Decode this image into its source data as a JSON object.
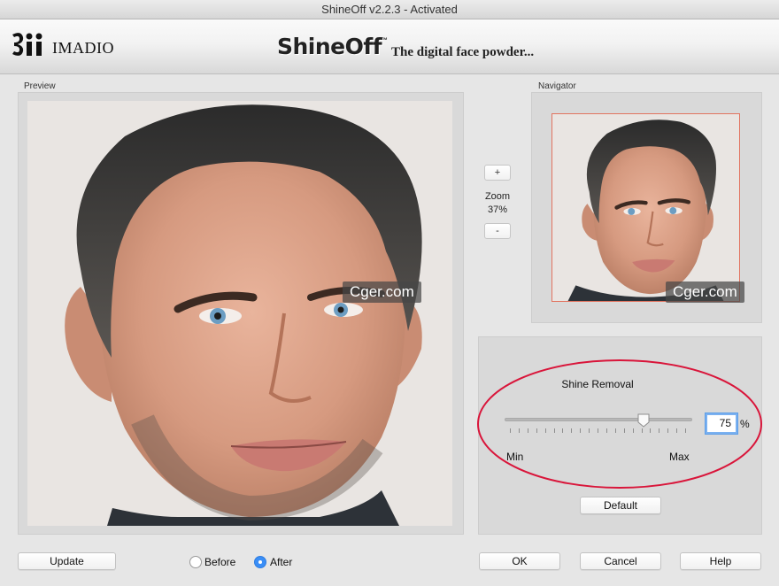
{
  "window": {
    "title": "ShineOff v2.2.3 - Activated"
  },
  "banner": {
    "company": "IMADIO",
    "product": "ShineOff",
    "trademark": "™",
    "tagline": "The digital face powder..."
  },
  "preview": {
    "label": "Preview",
    "watermark": "Cger.com"
  },
  "navigator": {
    "label": "Navigator",
    "watermark": "Cger.com"
  },
  "zoom": {
    "plus": "+",
    "minus": "-",
    "label": "Zoom",
    "value": "37%"
  },
  "shine": {
    "title": "Shine Removal",
    "value": "75",
    "unit": "%",
    "min_label": "Min",
    "max_label": "Max",
    "slider_fraction": 0.75,
    "default_label": "Default"
  },
  "footer": {
    "update_label": "Update",
    "before_label": "Before",
    "after_label": "After",
    "selected": "After",
    "ok_label": "OK",
    "cancel_label": "Cancel",
    "help_label": "Help"
  },
  "colors": {
    "highlight_ring": "#d9153a",
    "radio_selected": "#3a8ef6",
    "focus_border": "#7bb1f0"
  }
}
